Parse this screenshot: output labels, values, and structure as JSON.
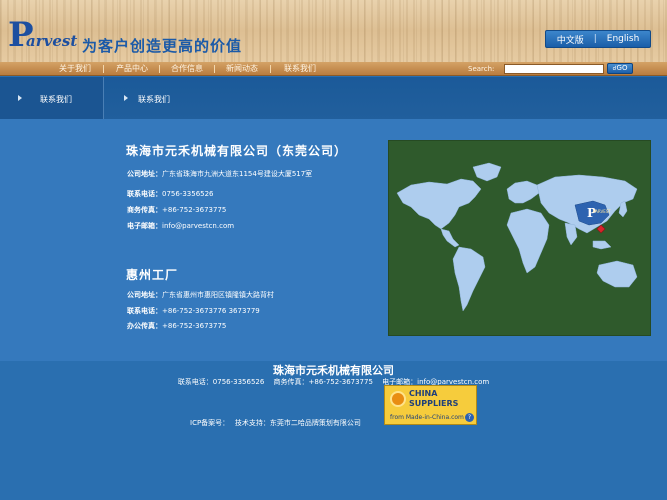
{
  "header": {
    "logo_initial": "P",
    "logo_rest": "arvest",
    "slogan": "为客户创造更高的价值",
    "lang_cn": "中文版",
    "lang_sep": "|",
    "lang_en": "English"
  },
  "nav": {
    "items": [
      {
        "label": "关于我们"
      },
      {
        "label": "产品中心"
      },
      {
        "label": "合作信息"
      },
      {
        "label": "新闻动态"
      },
      {
        "label": "联系我们"
      }
    ],
    "search_label": "Search:",
    "search_value": "",
    "go_label": "GO"
  },
  "breadcrumb": {
    "left_label": "联系我们",
    "right_label": "联系我们"
  },
  "company1": {
    "title": "珠海市元禾机械有限公司（东莞公司）",
    "address_label": "公司地址：",
    "address": "广东省珠海市九洲大道东1154号建设大厦517室",
    "phone_label": "联系电话：",
    "phone": "0756-3356526",
    "fax_label": "商务传真：",
    "fax": "+86-752-3673775",
    "email_label": "电子邮箱：",
    "email": "info@parvestcn.com"
  },
  "company2": {
    "title": "惠州工厂",
    "address_label": "公司地址：",
    "address": "广东省惠州市惠阳区镇隆镇大路背村",
    "phone_label": "联系电话：",
    "phone": "+86-752-3673776 3673779",
    "fax_label": "办公传真：",
    "fax": "+86-752-3673775"
  },
  "map": {
    "marker_label": "PARVEST"
  },
  "footer": {
    "title": "珠海市元禾机械有限公司",
    "contact": "联系电话：0756-3356526　 商务传真：+86-752-3673775　 电子邮箱：info@parvestcn.com",
    "icp": "ICP备案号：　 技术支持：东莞市二哈品牌策划有限公司",
    "badge_line1": "CHINA",
    "badge_line2": "SUPPLIERS",
    "badge_line3": "from Made-in-China.com",
    "badge_help": "?"
  },
  "colors": {
    "page_blue": "#2a6fb0",
    "content_blue": "#3579bd",
    "nav_brown": "#b97c3e",
    "map_green": "#2f5a2c",
    "land": "#aecdee",
    "marker_red": "#d8242a"
  }
}
